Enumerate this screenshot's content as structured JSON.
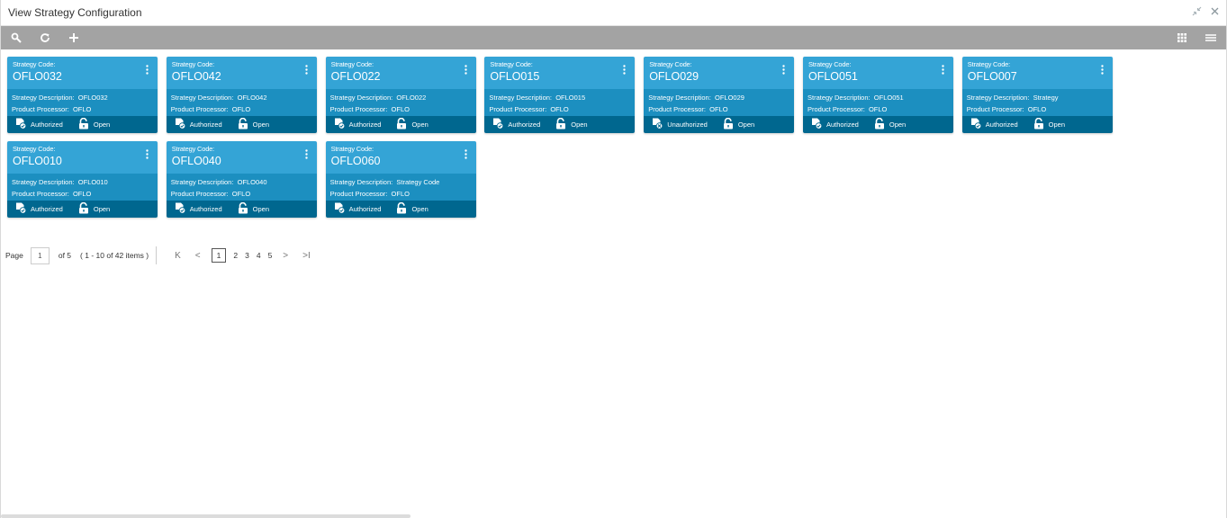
{
  "window": {
    "title": "View Strategy Configuration"
  },
  "toolbar": {
    "search_icon": "search-icon",
    "refresh_icon": "refresh-icon",
    "add_icon": "plus-icon",
    "tile_view_icon": "grid-icon",
    "list_view_icon": "list-icon"
  },
  "cards": [
    {
      "code_label": "Strategy Code:",
      "code": "OFLO032",
      "desc_label": "Strategy Description:",
      "desc": "OFLO032",
      "proc_label": "Product Processor:",
      "proc": "OFLO",
      "auth": "Authorized",
      "status": "Open"
    },
    {
      "code_label": "Strategy Code:",
      "code": "OFLO042",
      "desc_label": "Strategy Description:",
      "desc": "OFLO042",
      "proc_label": "Product Processor:",
      "proc": "OFLO",
      "auth": "Authorized",
      "status": "Open"
    },
    {
      "code_label": "Strategy Code:",
      "code": "OFLO022",
      "desc_label": "Strategy Description:",
      "desc": "OFLO022",
      "proc_label": "Product Processor:",
      "proc": "OFLO",
      "auth": "Authorized",
      "status": "Open"
    },
    {
      "code_label": "Strategy Code:",
      "code": "OFLO015",
      "desc_label": "Strategy Description:",
      "desc": "OFLO015",
      "proc_label": "Product Processor:",
      "proc": "OFLO",
      "auth": "Authorized",
      "status": "Open"
    },
    {
      "code_label": "Strategy Code:",
      "code": "OFLO029",
      "desc_label": "Strategy Description:",
      "desc": "OFLO029",
      "proc_label": "Product Processor:",
      "proc": "OFLO",
      "auth": "Unauthorized",
      "status": "Open"
    },
    {
      "code_label": "Strategy Code:",
      "code": "OFLO051",
      "desc_label": "Strategy Description:",
      "desc": "OFLO051",
      "proc_label": "Product Processor:",
      "proc": "OFLO",
      "auth": "Authorized",
      "status": "Open"
    },
    {
      "code_label": "Strategy Code:",
      "code": "OFLO007",
      "desc_label": "Strategy Description:",
      "desc": "Strategy",
      "proc_label": "Product Processor:",
      "proc": "OFLO",
      "auth": "Authorized",
      "status": "Open"
    },
    {
      "code_label": "Strategy Code:",
      "code": "OFLO010",
      "desc_label": "Strategy Description:",
      "desc": "OFLO010",
      "proc_label": "Product Processor:",
      "proc": "OFLO",
      "auth": "Authorized",
      "status": "Open"
    },
    {
      "code_label": "Strategy Code:",
      "code": "OFLO040",
      "desc_label": "Strategy Description:",
      "desc": "OFLO040",
      "proc_label": "Product Processor:",
      "proc": "OFLO",
      "auth": "Authorized",
      "status": "Open"
    },
    {
      "code_label": "Strategy Code:",
      "code": "OFLO060",
      "desc_label": "Strategy Description:",
      "desc": "Strategy Code",
      "proc_label": "Product Processor:",
      "proc": "OFLO",
      "auth": "Authorized",
      "status": "Open"
    }
  ],
  "pager": {
    "page_label": "Page",
    "current": "1",
    "of_label": "of 5",
    "range": "( 1 - 10 of 42 items )",
    "pages": [
      "1",
      "2",
      "3",
      "4",
      "5"
    ],
    "first": "K",
    "prev": "<",
    "next": ">",
    "last": ">I"
  },
  "colors": {
    "card_head": "#34a4d6",
    "card_body": "#1c8fc0",
    "card_foot": "#00678f",
    "toolbar": "#a3a3a3"
  }
}
